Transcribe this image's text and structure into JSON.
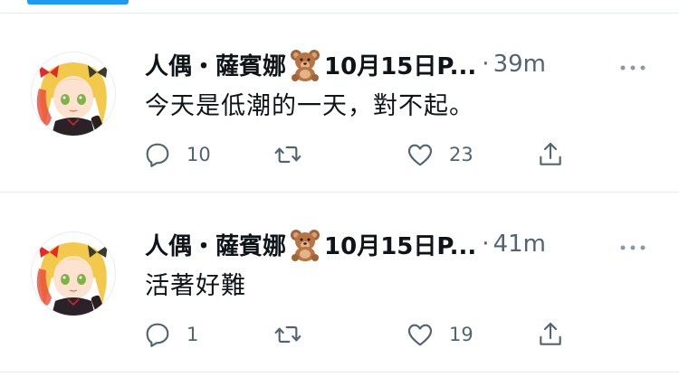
{
  "timeline": {
    "tweets": [
      {
        "display_name": "人偶・薩賓娜",
        "name_emoji": "bear-emoji",
        "name_suffix": "10月15日P...",
        "separator": "·",
        "time": "39m",
        "text": "今天是低潮的一天，對不起。",
        "replies": "10",
        "retweets": "",
        "likes": "23"
      },
      {
        "display_name": "人偶・薩賓娜",
        "name_emoji": "bear-emoji",
        "name_suffix": "10月15日P...",
        "separator": "·",
        "time": "41m",
        "text": "活著好難",
        "replies": "1",
        "retweets": "",
        "likes": "19"
      }
    ]
  },
  "colors": {
    "accent": "#1d9bf0",
    "text_primary": "#0f1419",
    "text_secondary": "#536471",
    "divider": "#e6ecf0"
  },
  "icons": {
    "reply": "reply-icon",
    "retweet": "retweet-icon",
    "like": "heart-icon",
    "share": "share-icon",
    "more": "more-icon"
  }
}
